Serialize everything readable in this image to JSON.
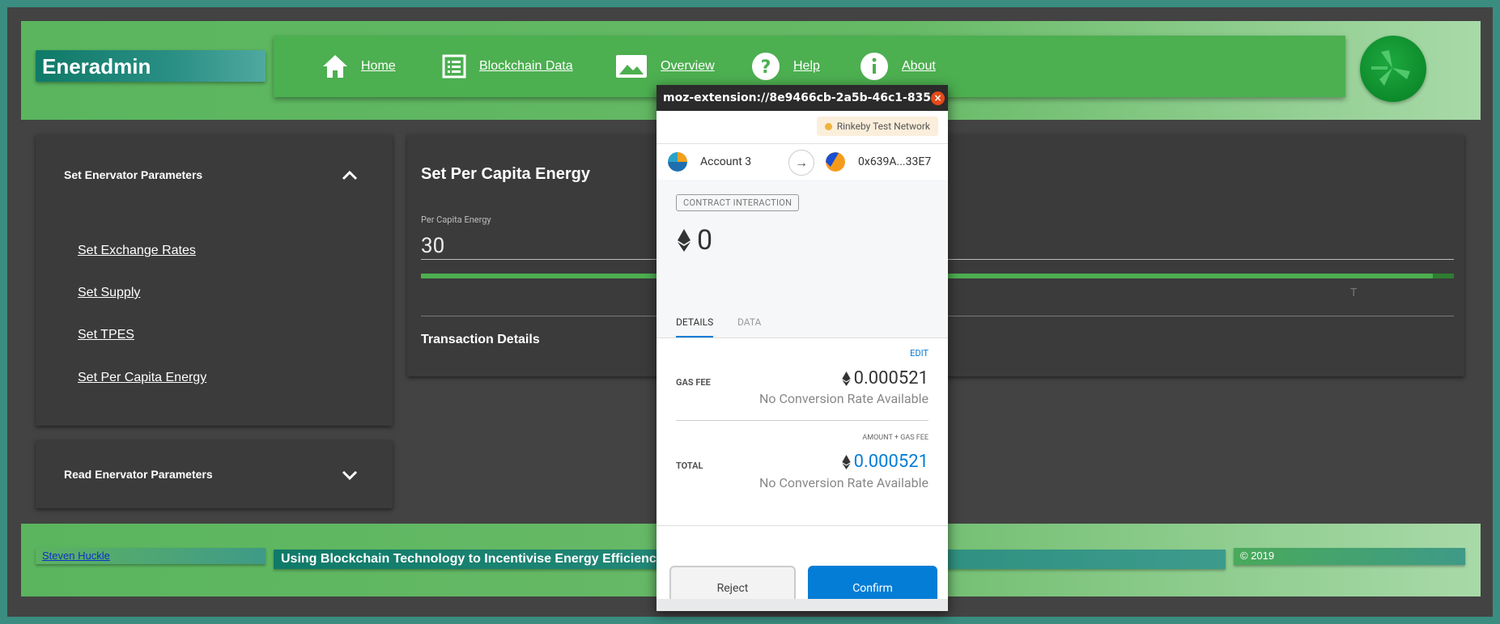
{
  "app": {
    "brand": "Eneradmin"
  },
  "nav": {
    "items": [
      {
        "label": "Home",
        "icon": "home-icon"
      },
      {
        "label": "Blockchain Data",
        "icon": "list-icon"
      },
      {
        "label": "Overview",
        "icon": "image-icon"
      },
      {
        "label": "Help",
        "icon": "help-icon"
      },
      {
        "label": "About",
        "icon": "info-icon"
      }
    ]
  },
  "sidebar": {
    "section1_title": "Set Enervator Parameters",
    "links": [
      "Set Exchange Rates",
      "Set Supply",
      "Set TPES",
      "Set Per Capita Energy"
    ],
    "section2_title": "Read Enervator Parameters"
  },
  "main": {
    "title": "Set Per Capita Energy",
    "field_label": "Per Capita Energy",
    "field_value": "30",
    "progress": 0.98,
    "ghost_text": "T",
    "tx_title": "Transaction Details"
  },
  "footer": {
    "author": "Steven Huckle",
    "tagline": "Using Blockchain Technology to Incentivise Energy Efficiency",
    "copyright": "© 2019"
  },
  "popup": {
    "title": "moz-extension://8e9466cb-2a5b-46c1-835d-d...",
    "close_label": "×",
    "network": "Rinkeby Test Network",
    "from_account": "Account 3",
    "to_address": "0x639A...33E7",
    "badge": "CONTRACT INTERACTION",
    "amount": "0",
    "tabs": {
      "details": "DETAILS",
      "data": "DATA"
    },
    "edit": "EDIT",
    "gas_fee_label": "GAS FEE",
    "gas_fee_value": "0.000521",
    "gas_fee_sub": "No Conversion Rate Available",
    "amount_gas_label": "AMOUNT + GAS FEE",
    "total_label": "TOTAL",
    "total_value": "0.000521",
    "total_sub": "No Conversion Rate Available",
    "reject": "Reject",
    "confirm": "Confirm"
  },
  "colors": {
    "accent_blue": "#037dd6",
    "header_green": "#4caf50",
    "teal": "#0f7a68"
  }
}
